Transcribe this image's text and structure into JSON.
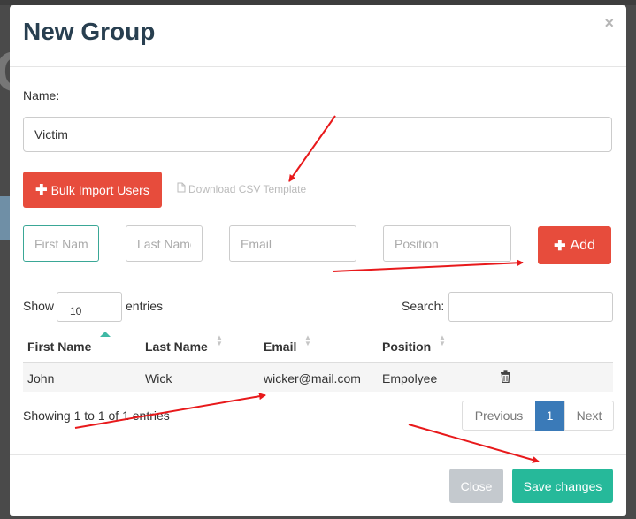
{
  "modal": {
    "title": "New Group",
    "close_icon": "close-icon",
    "name_label": "Name:",
    "name_value": "Victim",
    "bulk_import_label": "Bulk Import Users",
    "download_csv_label": "Download CSV Template",
    "placeholders": {
      "first_name": "First Name",
      "last_name": "Last Name",
      "email": "Email",
      "position": "Position"
    },
    "add_label": "Add"
  },
  "table": {
    "show_label": "Show",
    "entries_value": "10",
    "entries_label": "entries",
    "search_label": "Search:",
    "columns": [
      "First Name",
      "Last Name",
      "Email",
      "Position"
    ],
    "rows": [
      {
        "first_name": "John",
        "last_name": "Wick",
        "email": "wicker@mail.com",
        "position": "Empolyee",
        "action_icon": "trash-icon"
      }
    ],
    "showing_text": "Showing 1 to 1 of 1 entries",
    "pagination": {
      "previous": "Previous",
      "current": "1",
      "next": "Next"
    }
  },
  "footer": {
    "close_label": "Close",
    "save_label": "Save changes"
  },
  "colors": {
    "danger": "#e74c3c",
    "success": "#26b99a",
    "primary": "#3a7ab8",
    "title": "#283f50",
    "annotation_arrow": "#e8191b"
  }
}
